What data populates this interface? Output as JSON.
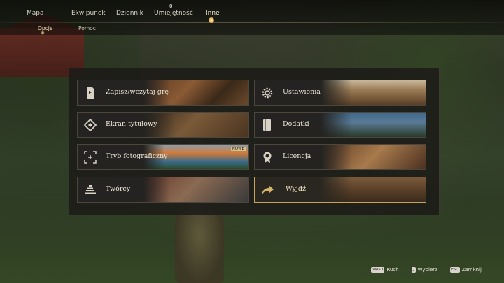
{
  "nav": {
    "tabs": [
      {
        "label": "Mapa"
      },
      {
        "label": "Ekwipunek"
      },
      {
        "label": "Dziennik"
      },
      {
        "label": "Umiejętność",
        "badge": "0"
      },
      {
        "label": "Inne",
        "active": true
      }
    ],
    "subtabs": [
      {
        "label": "Opcje",
        "active": true
      },
      {
        "label": "Pomoc"
      }
    ]
  },
  "menu": {
    "items": [
      {
        "label": "Zapisz/wczytaj grę",
        "icon": "save-load-icon"
      },
      {
        "label": "Ustawienia",
        "icon": "gear-icon"
      },
      {
        "label": "Ekran tytułowy",
        "icon": "title-screen-icon"
      },
      {
        "label": "Dodatki",
        "icon": "book-icon"
      },
      {
        "label": "Tryb fotograficzny",
        "icon": "camera-frame-icon",
        "tag": "NOWE"
      },
      {
        "label": "Licencja",
        "icon": "medal-icon"
      },
      {
        "label": "Twórcy",
        "icon": "credits-stack-icon"
      },
      {
        "label": "Wyjdź",
        "icon": "exit-arrow-icon",
        "selected": true
      }
    ]
  },
  "footer": {
    "hints": [
      {
        "key": "WASD",
        "label": "Ruch"
      },
      {
        "key": "⎵",
        "label": "Wybierz"
      },
      {
        "key": "ESC",
        "label": "Zamknij"
      }
    ]
  },
  "colors": {
    "accent": "#c8a45a",
    "panel": "#1c1b18",
    "text": "#ece6d6"
  }
}
